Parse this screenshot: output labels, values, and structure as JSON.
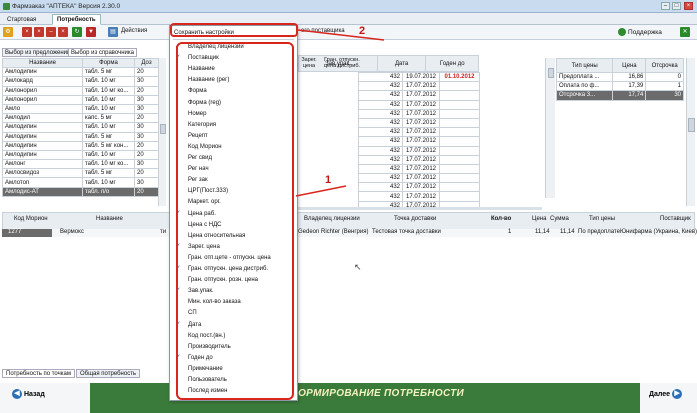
{
  "titlebar": {
    "title": "Фармзаказ \"АПТЕКА\" Версия 2.30.0"
  },
  "tabs": [
    "Стартовая",
    "Потребность"
  ],
  "toolbar": {
    "actions_label": "Действия",
    "text_right": "его поставщика",
    "support_label": "Поддержка"
  },
  "subtabs": [
    "Выбор из предложений",
    "Выбор из справочника"
  ],
  "left_table": {
    "headers": [
      "Название",
      "Форма",
      "Доз"
    ],
    "rows": [
      [
        "Амлодипин",
        "табл. 5 мг",
        "20"
      ],
      [
        "Амлокард",
        "табл. 10 мг",
        "30"
      ],
      [
        "Амлонорил",
        "табл. 10 мг ко...",
        "20"
      ],
      [
        "Амлонорил",
        "табл. 10 мг",
        "30"
      ],
      [
        "Амло",
        "табл. 10 мг",
        "30"
      ],
      [
        "Амлодил",
        "капс. 5 мг",
        "20"
      ],
      [
        "Амлодипин",
        "табл. 10 мг",
        "30"
      ],
      [
        "Амлодипин",
        "табл. 5 мг",
        "30"
      ],
      [
        "Амлодипин",
        "табл. 5 мг кон...",
        "20"
      ],
      [
        "Амлодипин",
        "табл. 10 мг",
        "20"
      ],
      [
        "Амлонг",
        "табл. 10 мг ко...",
        "30"
      ],
      [
        "Амлосвидоз",
        "табл. 5 мг",
        "20"
      ],
      [
        "Амлотоп",
        "табл. 10 мг",
        "30"
      ],
      [
        "Амлодис-АТ",
        "табл. п/о",
        "20"
      ]
    ]
  },
  "mid_table": {
    "headers": [
      "Зарег. цена",
      "Гран. отпускн. цена дистриб.",
      "Зав.упак.",
      "Дата",
      "Годен до"
    ],
    "rows": [
      [
        "432",
        "19.07.2012",
        "01.10.2012"
      ],
      [
        "432",
        "17.07.2012",
        ""
      ],
      [
        "432",
        "17.07.2012",
        ""
      ],
      [
        "432",
        "17.07.2012",
        ""
      ],
      [
        "432",
        "17.07.2012",
        ""
      ],
      [
        "432",
        "17.07.2012",
        ""
      ],
      [
        "432",
        "17.07.2012",
        ""
      ],
      [
        "432",
        "17.07.2012",
        ""
      ],
      [
        "432",
        "17.07.2012",
        ""
      ],
      [
        "432",
        "17.07.2012",
        ""
      ],
      [
        "432",
        "17.07.2012",
        ""
      ],
      [
        "432",
        "17.07.2012",
        ""
      ],
      [
        "432",
        "17.07.2012",
        ""
      ],
      [
        "432",
        "17.07.2012",
        ""
      ],
      [
        "432",
        "17.07.2012",
        ""
      ]
    ]
  },
  "right_table": {
    "headers": [
      "Тип цены",
      "Цена",
      "Отсрочка"
    ],
    "rows": [
      [
        "Предоплата ...",
        "16,86",
        "0"
      ],
      [
        "Оплата по ф...",
        "17,39",
        "1"
      ],
      [
        "Отсрочка 3...",
        "17,74",
        "30"
      ]
    ]
  },
  "bottom_table": {
    "headers": [
      "Код Морион",
      "Название",
      "Владелец лицензии",
      "Точка доставки",
      "Кол-во",
      "Цена",
      "Сумма",
      "Тип цены",
      "Поставщик"
    ],
    "row": [
      "1277",
      "Вермокс",
      "Gedeon Richter (Венгрия)",
      "Тестовая точка доставки",
      "1",
      "11,14",
      "11,14",
      "По предоплате",
      "Юнифарма (Украина, Киев)"
    ],
    "left_stub": "ти"
  },
  "bottom_tabs": [
    "Потребность по точкам",
    "Общая потребность"
  ],
  "context_menu": {
    "save_label": "Сохранить настройки",
    "items": [
      {
        "label": "Владелец лицензии",
        "checked": true
      },
      {
        "label": "Поставщик",
        "checked": true
      },
      {
        "label": "Название",
        "checked": false
      },
      {
        "label": "Название (рег)",
        "checked": false
      },
      {
        "label": "Форма",
        "checked": false
      },
      {
        "label": "Форма (reg)",
        "checked": false
      },
      {
        "label": "Номер",
        "checked": false
      },
      {
        "label": "Категория",
        "checked": false
      },
      {
        "label": "Рецепт",
        "checked": false
      },
      {
        "label": "Код Морион",
        "checked": false
      },
      {
        "label": "Рег свид",
        "checked": false
      },
      {
        "label": "Рег нач",
        "checked": false
      },
      {
        "label": "Рег зак",
        "checked": false
      },
      {
        "label": "ЦРГ(Пост.333)",
        "checked": false
      },
      {
        "label": "Маркет. орг.",
        "checked": false
      },
      {
        "label": "Цена раб.",
        "checked": true
      },
      {
        "label": "Цена с НДС",
        "checked": false
      },
      {
        "label": "Цена относительная",
        "checked": false
      },
      {
        "label": "Зарег. цена",
        "checked": true
      },
      {
        "label": "Гран. отп.цете - отпускн. цена",
        "checked": false
      },
      {
        "label": "Гран. отпускн. цена дистриб.",
        "checked": true
      },
      {
        "label": "Гран. отпускн. розн. цена",
        "checked": false
      },
      {
        "label": "Зав.упак.",
        "checked": true
      },
      {
        "label": "Мин. кол-во заказа",
        "checked": false
      },
      {
        "label": "СП",
        "checked": false
      },
      {
        "label": "Дата",
        "checked": true
      },
      {
        "label": "Код пост.(вн.)",
        "checked": false
      },
      {
        "label": "Производитель",
        "checked": false
      },
      {
        "label": "Годен до",
        "checked": true
      },
      {
        "label": "Примечание",
        "checked": false
      },
      {
        "label": "Пользователь",
        "checked": false
      },
      {
        "label": "Послед измен",
        "checked": false
      }
    ]
  },
  "annotations": {
    "one": "1",
    "two": "2"
  },
  "footer": {
    "back_label": "Назад",
    "next_label": "Далее",
    "banner": "ФОРМИРОВАНИЕ ПОТРЕБНОСТИ"
  },
  "colors": {
    "accent_red": "#d8261c",
    "footer_green": "#3a7a3a",
    "selected_row": "#6b6b6b"
  }
}
